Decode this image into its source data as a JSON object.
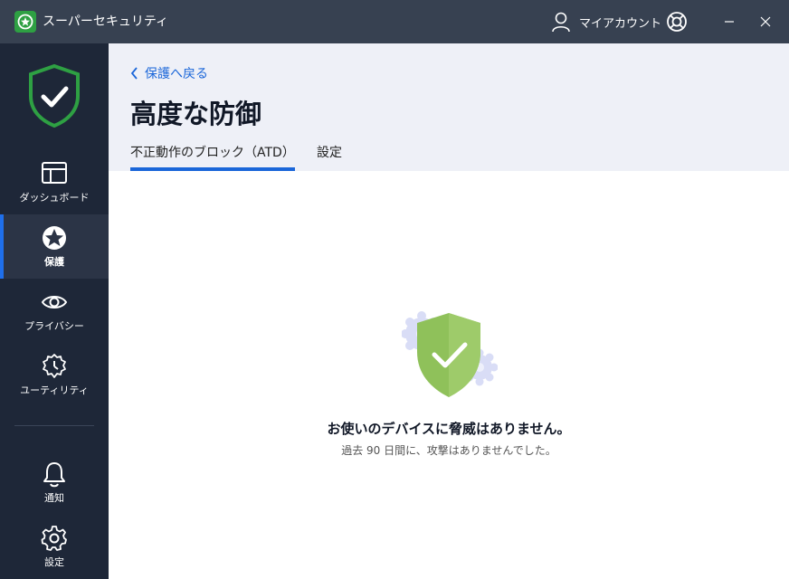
{
  "app": {
    "title": "スーパーセキュリティ"
  },
  "titlebar": {
    "account_label": "マイアカウント"
  },
  "sidebar": {
    "items": [
      {
        "id": "dashboard",
        "label": "ダッシュボード",
        "icon": "dashboard-icon"
      },
      {
        "id": "protection",
        "label": "保護",
        "icon": "protection-icon",
        "active": true
      },
      {
        "id": "privacy",
        "label": "プライバシー",
        "icon": "eye-icon"
      },
      {
        "id": "utility",
        "label": "ユーティリティ",
        "icon": "utility-icon"
      },
      {
        "id": "notifications",
        "label": "通知",
        "icon": "bell-icon"
      },
      {
        "id": "settings",
        "label": "設定",
        "icon": "gear-icon"
      }
    ]
  },
  "header": {
    "back_label": "保護へ戻る",
    "title": "高度な防御",
    "tabs": [
      {
        "label": "不正動作のブロック（ATD）",
        "active": true
      },
      {
        "label": "設定",
        "active": false
      }
    ]
  },
  "main": {
    "empty_title": "お使いのデバイスに脅威はありません。",
    "empty_subtitle": "過去 90 日間に、攻撃はありませんでした。"
  },
  "colors": {
    "titlebar": "#374151",
    "sidebar": "#1e2738",
    "accent": "#1a66d9",
    "brand_green": "#2ea043",
    "shield_green": "#8fc15a"
  }
}
